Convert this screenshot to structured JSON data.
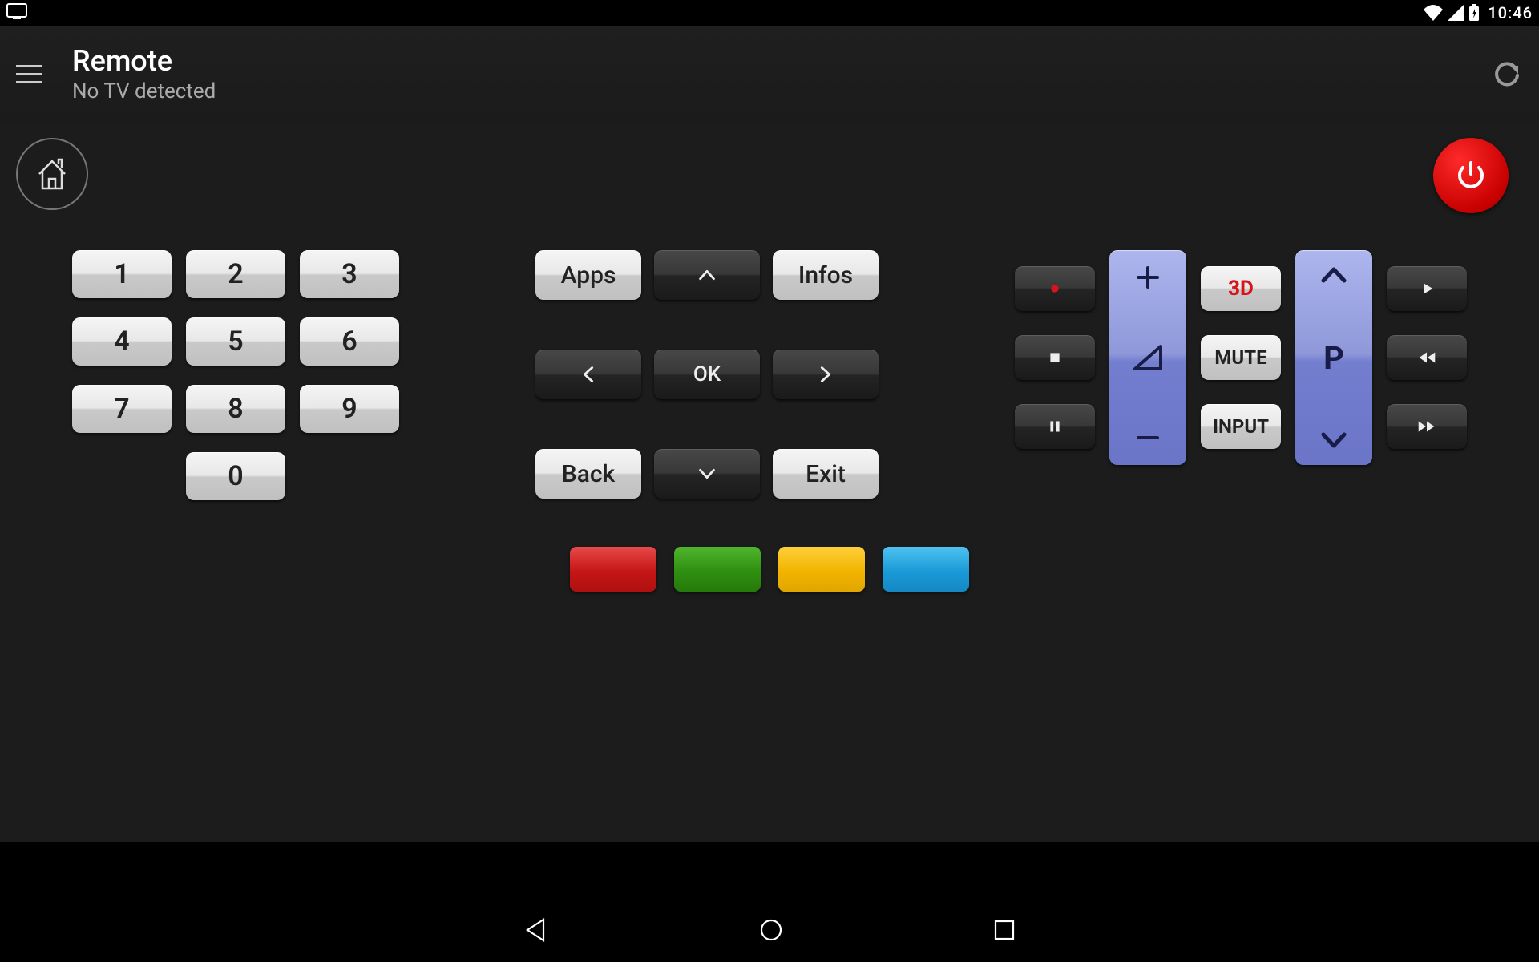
{
  "status": {
    "time": "10:46"
  },
  "appbar": {
    "title": "Remote",
    "subtitle": "No TV detected"
  },
  "keypad": {
    "1": "1",
    "2": "2",
    "3": "3",
    "4": "4",
    "5": "5",
    "6": "6",
    "7": "7",
    "8": "8",
    "9": "9",
    "0": "0"
  },
  "nav": {
    "apps": "Apps",
    "infos": "Infos",
    "ok": "OK",
    "back": "Back",
    "exit": "Exit"
  },
  "right": {
    "threeD": "3D",
    "mute": "MUTE",
    "input": "INPUT",
    "program": "P"
  },
  "colors": {
    "red": "#c51616",
    "green": "#2f8f10",
    "yellow": "#f2b400",
    "blue": "#1a9ad8"
  }
}
